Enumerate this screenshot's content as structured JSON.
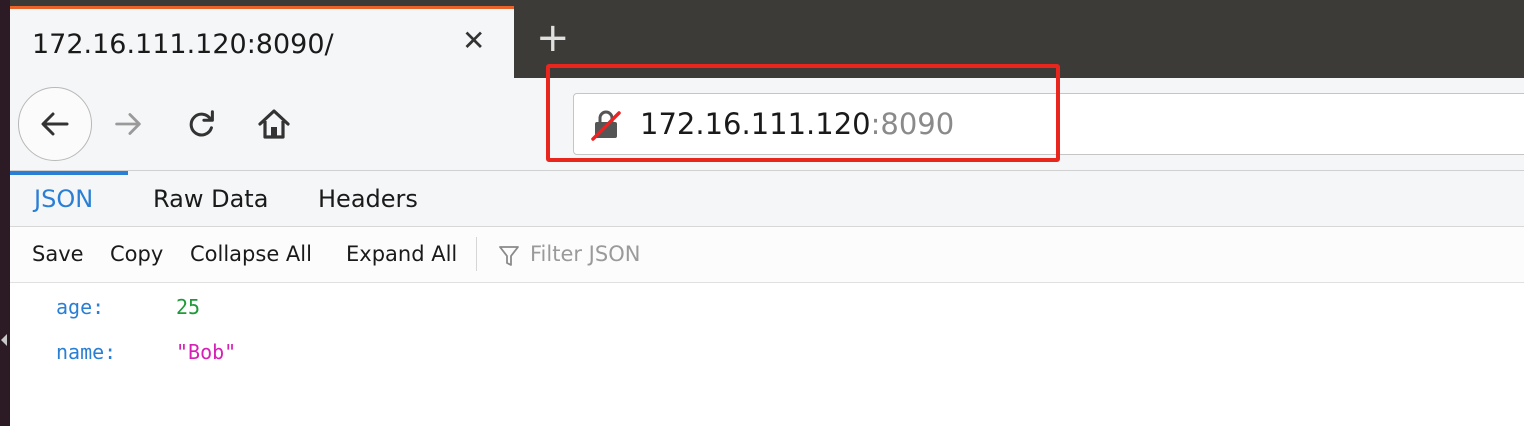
{
  "tab": {
    "title": "172.16.111.120:8090/",
    "close_glyph": "✕"
  },
  "new_tab_glyph": "+",
  "navigation": {
    "back_icon": "arrow-left-icon",
    "forward_icon": "arrow-right-icon",
    "reload_icon": "reload-icon",
    "home_icon": "home-icon"
  },
  "url": {
    "host": "172.16.111.120",
    "port": ":8090",
    "security_icon": "insecure-lock-icon"
  },
  "highlight_color": "#e8261e",
  "viewer_tabs": [
    {
      "label": "JSON",
      "active": true
    },
    {
      "label": "Raw Data",
      "active": false
    },
    {
      "label": "Headers",
      "active": false
    }
  ],
  "toolbar": {
    "save": "Save",
    "copy": "Copy",
    "collapse_all": "Collapse All",
    "expand_all": "Expand All",
    "filter_placeholder": "Filter JSON"
  },
  "json_rows": [
    {
      "key": "age:",
      "value": "25",
      "type": "number"
    },
    {
      "key": "name:",
      "value": "\"Bob\"",
      "type": "string"
    }
  ],
  "colors": {
    "accent": "#2a7fd5",
    "number": "#1f9a3a",
    "string": "#d620b6",
    "tab_indicator": "#e8642a"
  }
}
